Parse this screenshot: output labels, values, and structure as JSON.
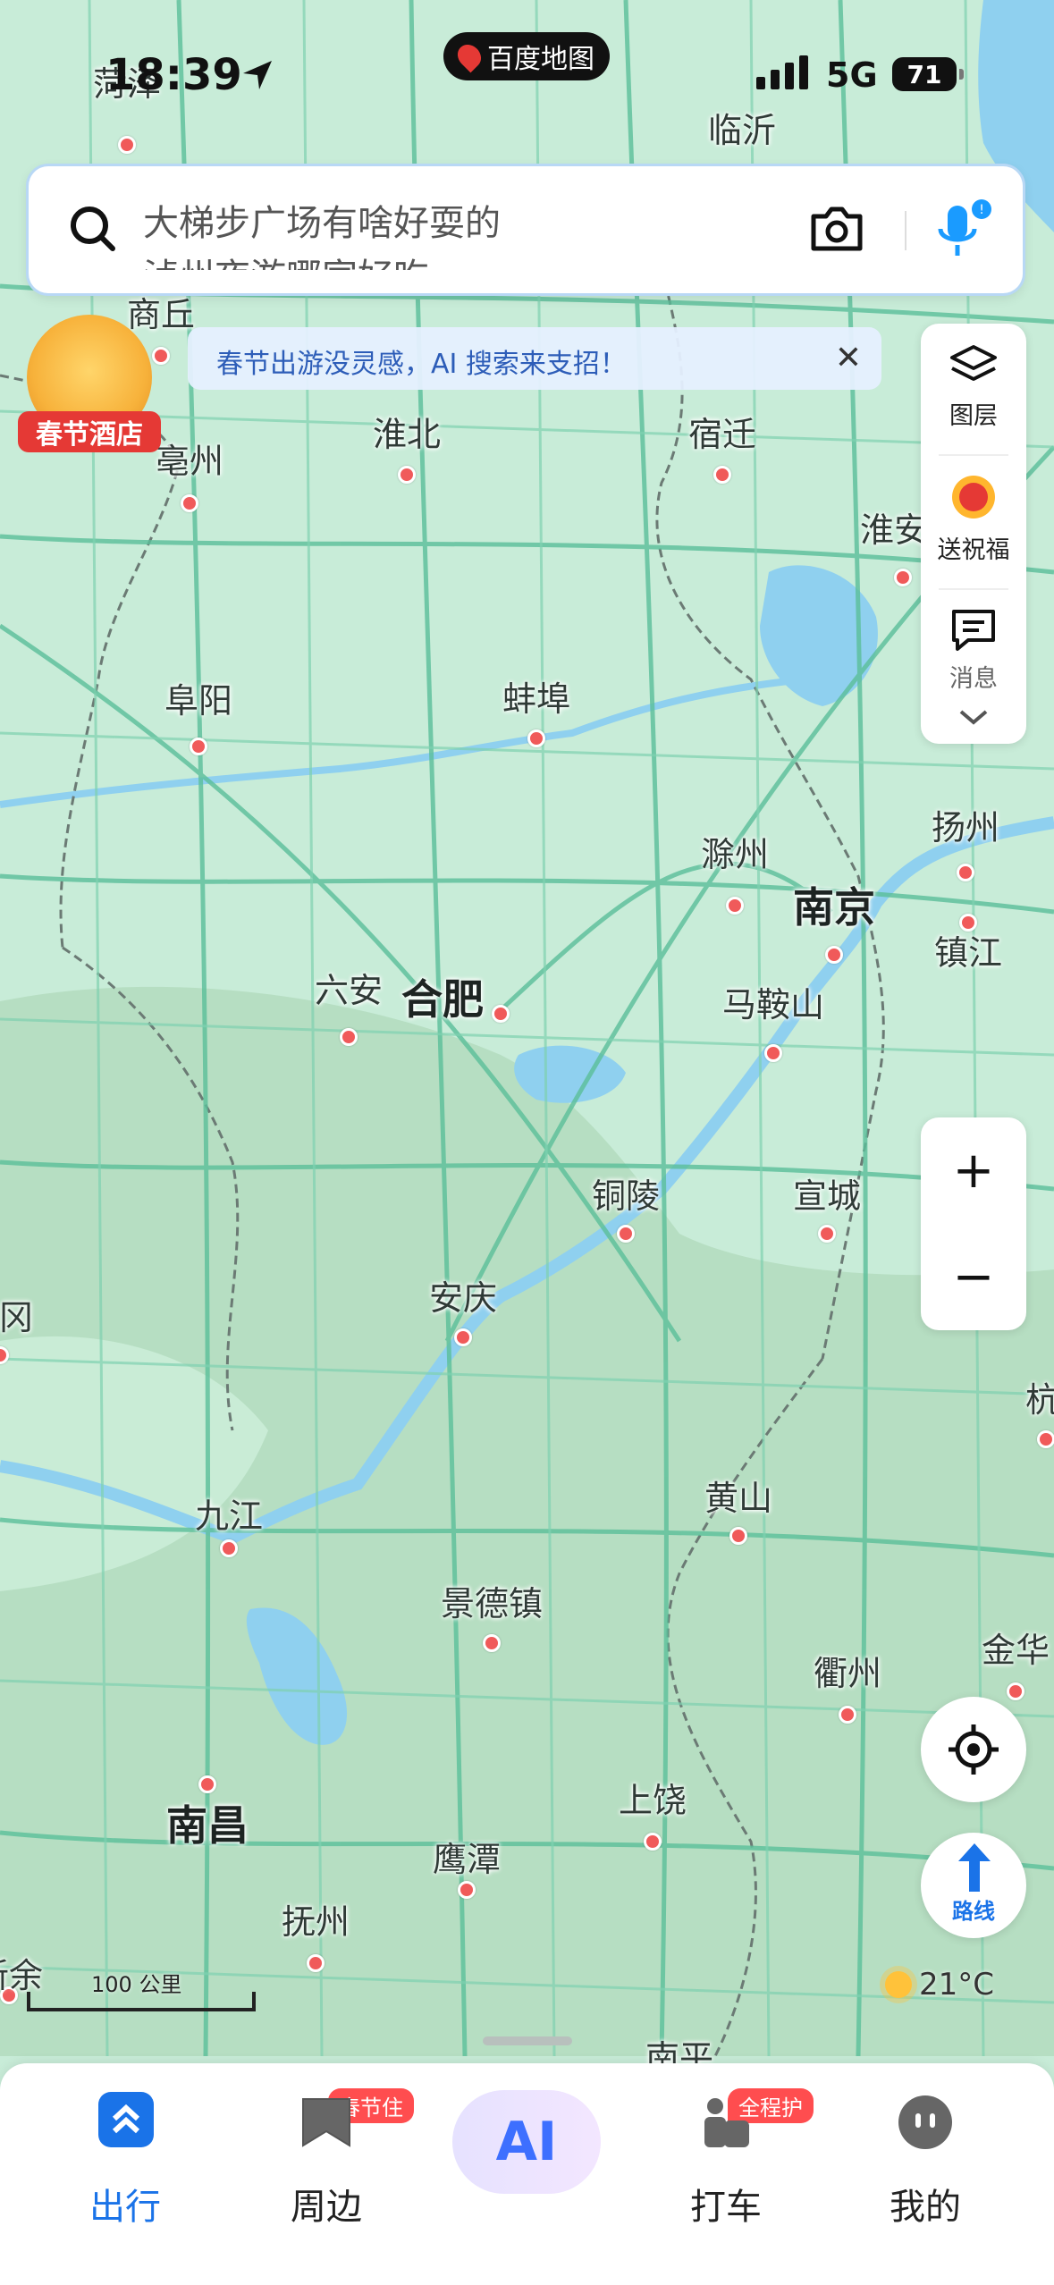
{
  "status_bar": {
    "time": "18:39",
    "app_name": "百度地图",
    "network": "5G",
    "battery": "71"
  },
  "search": {
    "placeholder_line1": "大梯步广场有啥好耍的",
    "placeholder_line2": "泸州夜游哪家好吃"
  },
  "notice": {
    "text": "春节出游没灵感，AI 搜索来支招！",
    "close": "✕"
  },
  "hotel_promo": {
    "label": "春节酒店"
  },
  "right_panel": {
    "layers": "图层",
    "blessing": "送祝福",
    "messages": "消息"
  },
  "zoom": {
    "in": "+",
    "out": "−"
  },
  "route": {
    "label": "路线"
  },
  "weather": {
    "temp": "21°C"
  },
  "scale": {
    "label": "100 公里"
  },
  "cities": [
    {
      "name": "菏泽",
      "big": false
    },
    {
      "name": "临沂",
      "big": false
    },
    {
      "name": "商丘",
      "big": false
    },
    {
      "name": "淮北",
      "big": false
    },
    {
      "name": "宿迁",
      "big": false
    },
    {
      "name": "亳州",
      "big": false
    },
    {
      "name": "淮安",
      "big": false
    },
    {
      "name": "阜阳",
      "big": false
    },
    {
      "name": "蚌埠",
      "big": false
    },
    {
      "name": "扬州",
      "big": false
    },
    {
      "name": "滁州",
      "big": false
    },
    {
      "name": "南京",
      "big": true
    },
    {
      "name": "镇江",
      "big": false
    },
    {
      "name": "六安",
      "big": false
    },
    {
      "name": "合肥",
      "big": true
    },
    {
      "name": "马鞍山",
      "big": false
    },
    {
      "name": "铜陵",
      "big": false
    },
    {
      "name": "宣城",
      "big": false
    },
    {
      "name": "安庆",
      "big": false
    },
    {
      "name": "冈",
      "big": false
    },
    {
      "name": "杭",
      "big": false
    },
    {
      "name": "黄山",
      "big": false
    },
    {
      "name": "九江",
      "big": false
    },
    {
      "name": "景德镇",
      "big": false
    },
    {
      "name": "衢州",
      "big": false
    },
    {
      "name": "金华",
      "big": false
    },
    {
      "name": "南昌",
      "big": true
    },
    {
      "name": "上饶",
      "big": false
    },
    {
      "name": "鹰潭",
      "big": false
    },
    {
      "name": "抚州",
      "big": false
    },
    {
      "name": "新余",
      "big": false
    },
    {
      "name": "南平",
      "big": false
    }
  ],
  "tabs": [
    {
      "label": "出行",
      "badge": ""
    },
    {
      "label": "周边",
      "badge": "春节住"
    },
    {
      "label": "AI",
      "badge": ""
    },
    {
      "label": "打车",
      "badge": "全程护"
    },
    {
      "label": "我的",
      "badge": ""
    }
  ],
  "colors": {
    "land": "#c8ecd8",
    "mountain": "#b4dcbf",
    "water": "#8fd0ef",
    "road": "#5bbf9a",
    "accent": "#1a73e8",
    "badge": "#ff4d4f"
  }
}
